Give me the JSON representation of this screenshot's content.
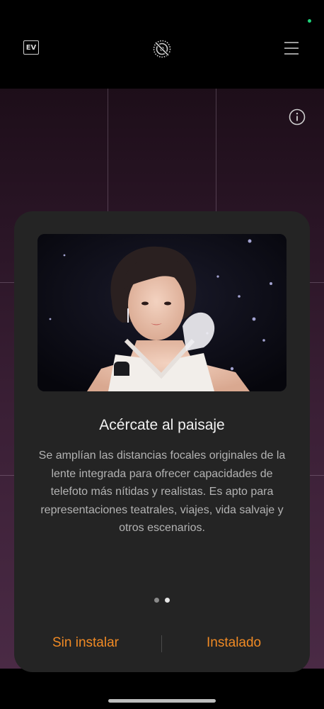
{
  "header": {
    "ev_label": "EV",
    "live_icon": "live-photo-off-icon",
    "menu_icon": "hamburger-menu-icon",
    "status_dot_color": "#1fd37a"
  },
  "viewfinder": {
    "info_icon": "info-icon"
  },
  "dialog": {
    "image_icon": "preview-image",
    "title": "Acércate al paisaje",
    "body": "Se amplían las distancias focales originales de la lente integrada para ofrecer capacidades de telefoto más nítidas y realistas. Es apto para representaciones teatrales, viajes, vida salvaje y otros escenarios.",
    "pager": {
      "count": 2,
      "active_index": 1,
      "inactive_color": "#8a8a8a",
      "active_color": "#e6e6e6"
    },
    "buttons": {
      "left": "Sin instalar",
      "right": "Instalado",
      "accent": "#f08a24"
    }
  }
}
